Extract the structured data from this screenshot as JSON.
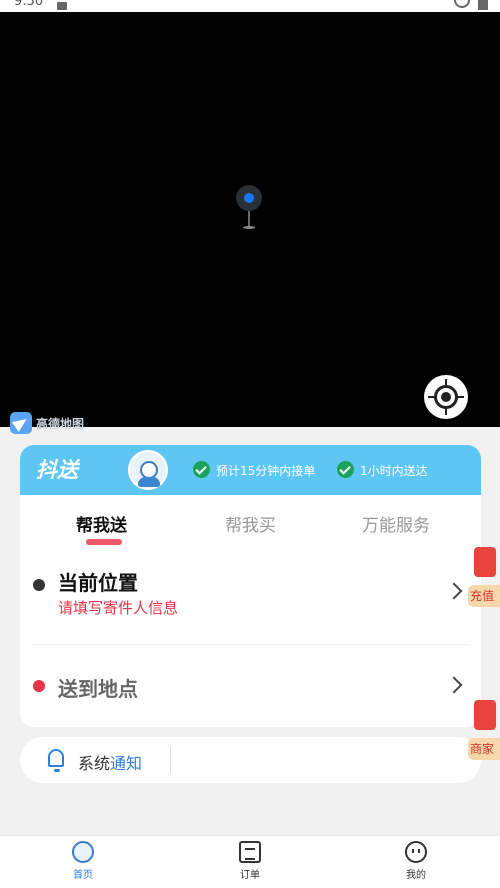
{
  "status_bar": {
    "time": "9:50"
  },
  "map": {
    "brand_text": "高德地图"
  },
  "card": {
    "brand": "抖送",
    "features": [
      "预计15分钟内接单",
      "1小时内送达"
    ],
    "tabs": [
      {
        "label": "帮我送",
        "active": true
      },
      {
        "label": "帮我买",
        "active": false
      },
      {
        "label": "万能服务",
        "active": false
      }
    ],
    "pickup": {
      "title": "当前位置",
      "subtitle": "请填写寄件人信息"
    },
    "dropoff": {
      "title": "送到地点"
    }
  },
  "notice": {
    "prefix": "系统",
    "highlight": "通知"
  },
  "floats": [
    {
      "label": "充值"
    },
    {
      "label": "商家"
    }
  ],
  "bottom_nav": [
    {
      "label": "首页",
      "active": true
    },
    {
      "label": "订单",
      "active": false
    },
    {
      "label": "我的",
      "active": false
    }
  ],
  "colors": {
    "accent": "#5ec6f4",
    "active_tab": "#2d7fe0",
    "alert": "#e8334a"
  }
}
